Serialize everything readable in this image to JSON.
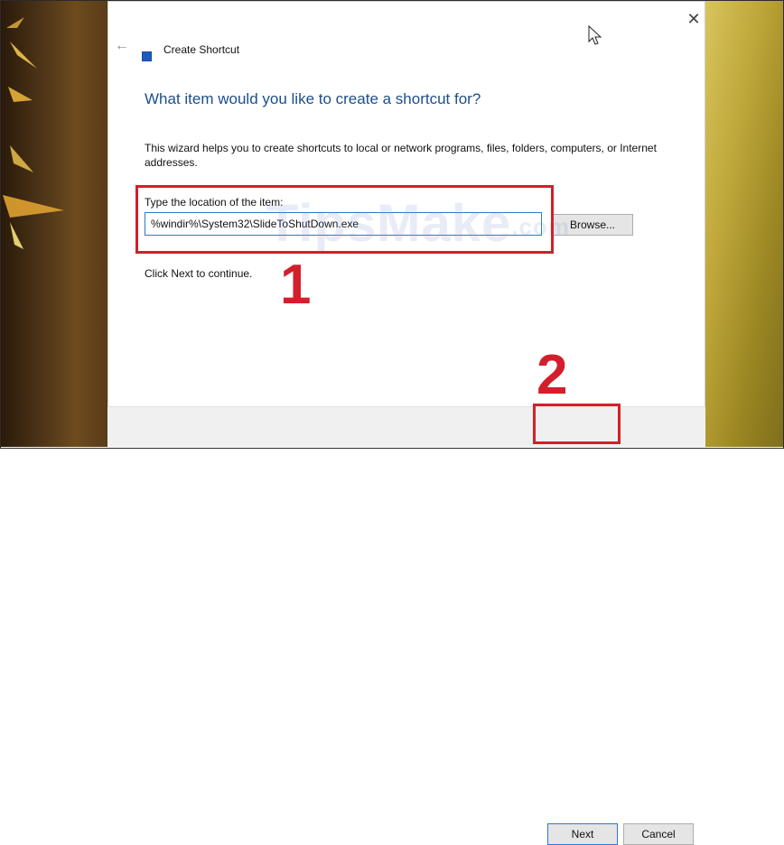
{
  "dialog": {
    "title": "Create Shortcut",
    "heading": "What item would you like to create a shortcut for?",
    "description": "This wizard helps you to create shortcuts to local or network programs, files, folders, computers, or Internet addresses.",
    "location_label": "Type the location of the item:",
    "location_value": "%windir%\\System32\\SlideToShutDown.exe",
    "browse_label": "Browse...",
    "continue_text": "Click Next to continue.",
    "next_label": "Next",
    "cancel_label": "Cancel",
    "close_glyph": "✕",
    "back_glyph": "←"
  },
  "annotations": {
    "step1": "1",
    "step2": "2",
    "accent_color": "#d31f2b"
  },
  "watermark": {
    "text": "TipsMake",
    "suffix": ".com"
  },
  "icons": {
    "back": "back-arrow-icon",
    "title": "shortcut-icon",
    "close": "close-icon",
    "cursor": "mouse-cursor-icon"
  }
}
